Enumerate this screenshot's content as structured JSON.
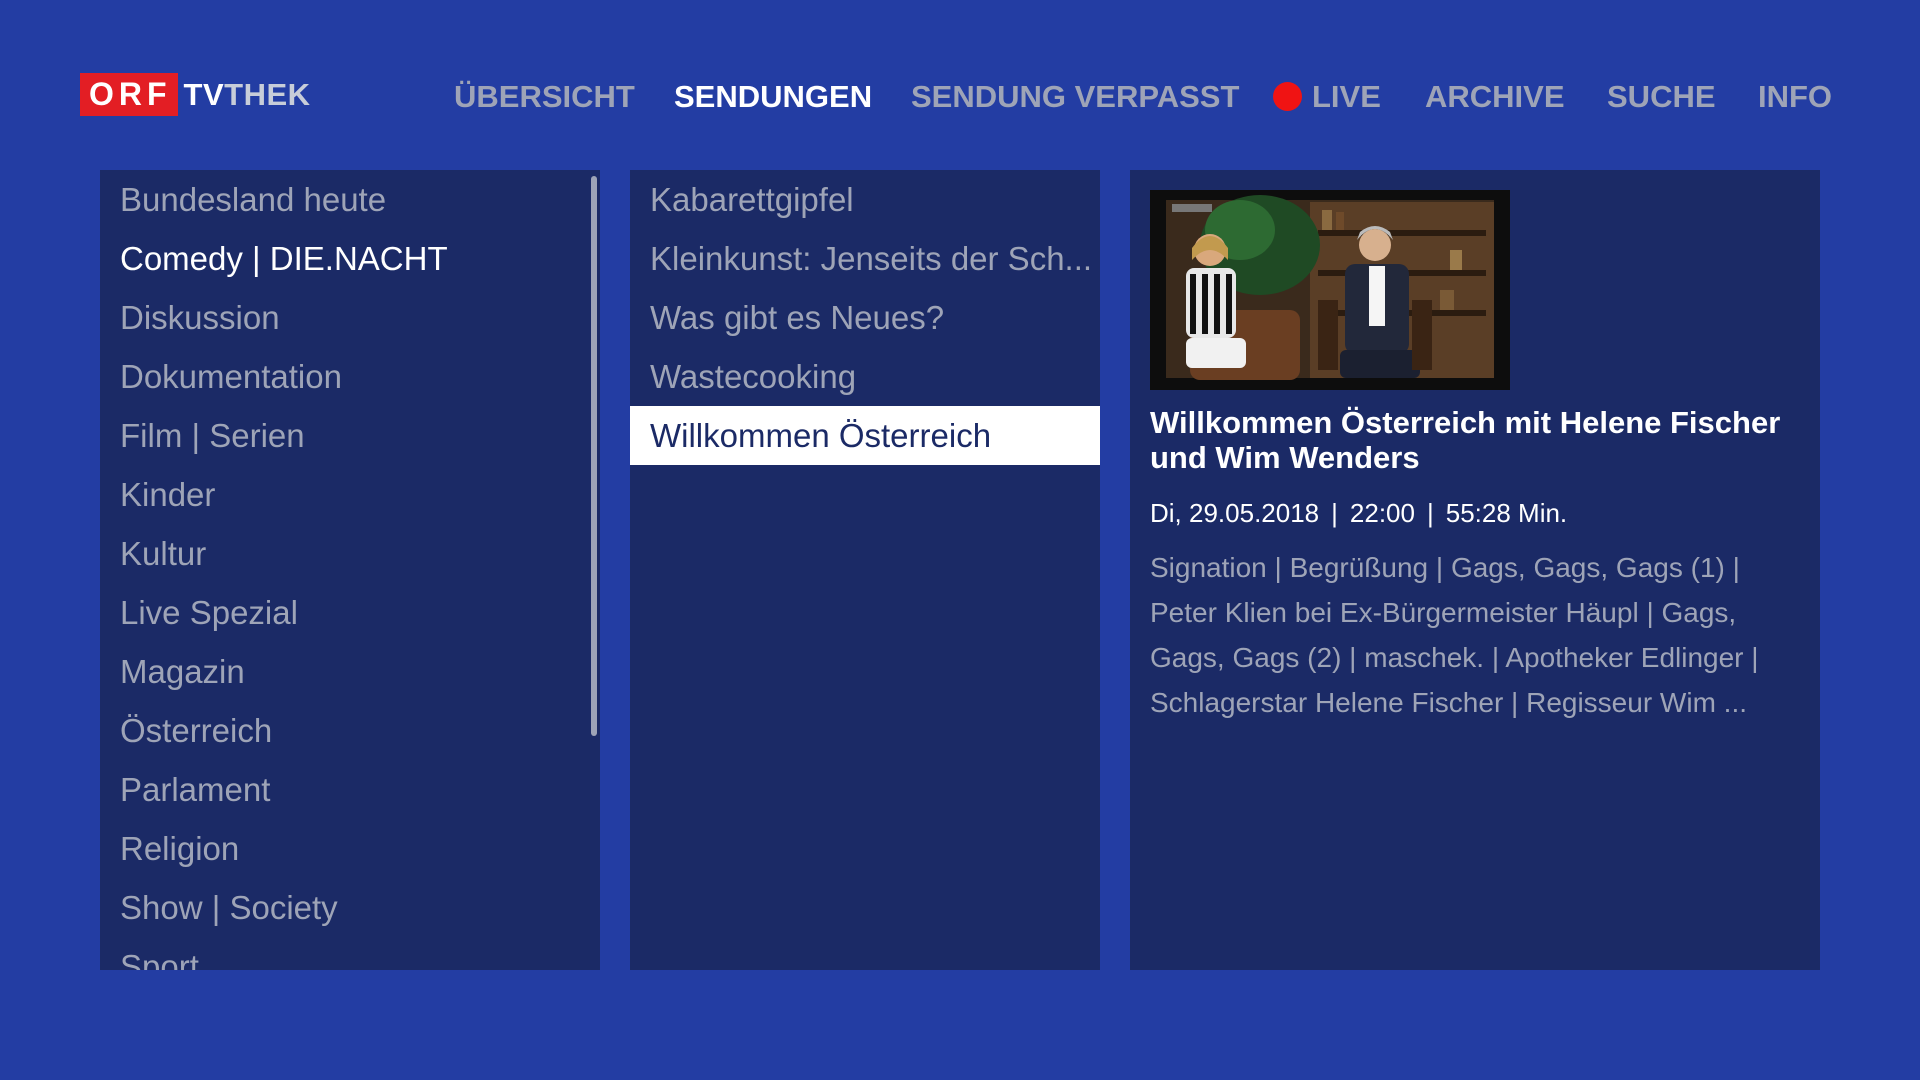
{
  "logo": {
    "orf": "ORF",
    "tv": "TV",
    "thek": "THEK"
  },
  "nav": {
    "items": [
      {
        "label": "ÜBERSICHT"
      },
      {
        "label": "SENDUNGEN"
      },
      {
        "label": "SENDUNG VERPASST"
      },
      {
        "label": "LIVE"
      },
      {
        "label": "ARCHIVE"
      },
      {
        "label": "SUCHE"
      },
      {
        "label": "INFO"
      }
    ],
    "active": "SENDUNGEN"
  },
  "categories": {
    "items": [
      "Bundesland heute",
      "Comedy | DIE.NACHT",
      "Diskussion",
      "Dokumentation",
      "Film | Serien",
      "Kinder",
      "Kultur",
      "Live Spezial",
      "Magazin",
      "Österreich",
      "Parlament",
      "Religion",
      "Show | Society",
      "Sport"
    ],
    "highlighted": "Comedy | DIE.NACHT"
  },
  "shows": {
    "items": [
      "Kabarettgipfel",
      "Kleinkunst: Jenseits der Sch...",
      "Was gibt es Neues?",
      "Wastecooking",
      "Willkommen Österreich"
    ],
    "selected": "Willkommen Österreich"
  },
  "detail": {
    "title": "Willkommen Österreich mit Helene Fischer und Wim Wenders",
    "date": "Di, 29.05.2018",
    "time": "22:00",
    "duration": "55:28 Min.",
    "separator": "|",
    "description": "Signation | Begrüßung | Gags, Gags, Gags (1) | Peter Klien bei Ex-Bürgermeister Häupl | Gags, Gags, Gags (2) | maschek. | Apotheker Edlinger | Schlagerstar Helene Fischer | Regisseur Wim ..."
  },
  "colors": {
    "background": "#233da3",
    "panel": "#1b2a66",
    "accent_live": "#f01313",
    "logo_red": "#e31e24",
    "muted_text": "#9ea4b7"
  }
}
